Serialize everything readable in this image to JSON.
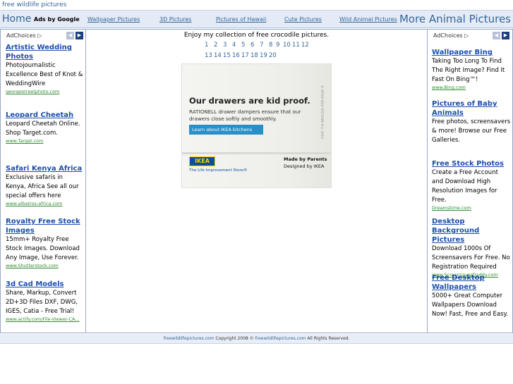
{
  "site": {
    "title": "free wildlife pictures"
  },
  "nav": {
    "home": "Home",
    "ads_by_google": "Ads by Google",
    "links": [
      "Wallpaper Pictures",
      "3D Pictures",
      "Pictures of Hawaii",
      "Cute Pictures",
      "Wild Animal Pictures"
    ],
    "more": "More Animal Pictures"
  },
  "left_ads": {
    "adchoices": "AdChoices ▷",
    "items": [
      {
        "title": "Artistic Wedding Photos",
        "desc": "Photojournalistic Excellence Best of Knot & WeddingWire",
        "url": "georgestreetphoto.com"
      },
      {
        "title": "Leopard Cheetah",
        "desc": "Leopard Cheetah Online. Shop Target.com.",
        "url": "www.Target.com"
      },
      {
        "title": "Safari Kenya Africa",
        "desc": "Exclusive safaris in Kenya, Africa See all our special offers here",
        "url": "www.albatros-africa.com"
      },
      {
        "title": "Royalty Free Stock Images",
        "desc": "15mm+ Royalty Free Stock Images. Download Any Image, Use Forever.",
        "url": "www.Shutterstock.com"
      },
      {
        "title": "3d Cad Models",
        "desc": "Share, Markup, Convert 2D+3D Files DXF, DWG, IGES, Catia - Free Trial!",
        "url": "www.actify.com/File-Viewer-CA..."
      }
    ]
  },
  "center": {
    "intro": "Enjoy my collection of free crocodile pictures.",
    "pages_row1": [
      "1",
      "2",
      "3",
      "4",
      "5",
      "6",
      "7",
      "8",
      "9",
      "10",
      "11",
      "12"
    ],
    "pages_row2": [
      "13",
      "14",
      "15",
      "16",
      "17",
      "18",
      "19",
      "20"
    ],
    "banner": {
      "headline": "Our drawers are kid proof.",
      "body": "RATIONELL drawer dampers ensure that our drawers close softly and smoothly.",
      "cta": "Learn about IKEA kitchens",
      "logo": "IKEA",
      "tagline": "The Life Improvement Store®",
      "made_by": "Made by Parents",
      "designed_by": "Designed by IKEA",
      "side_text": "© INTER IKEA SYSTEMS B.V. 2010"
    }
  },
  "right_ads": {
    "adchoices": "AdChoices ▷",
    "items": [
      {
        "title": "Wallpaper Bing",
        "desc": "Taking Too Long To Find The Right Image? Find It Fast On Bing™!",
        "url": "www.Bing.com"
      },
      {
        "title": "Pictures of Baby Animals",
        "desc": "Free photos, screensavers & more! Browse our Free Galleries.",
        "url": ""
      },
      {
        "title": "Free Stock Photos",
        "desc": "Create a Free Account and Download High Resolution Images for Free.",
        "url": "Dreamstime.com"
      },
      {
        "title": "Desktop Background Pictures",
        "desc": "Download 1000s Of Screensavers For Free. No Registration Required",
        "url": "www.ScreensaverDaddy.com"
      },
      {
        "title": "Free Desktop Wallpapers",
        "desc": "5000+ Great Computer Wallpapers Download Now! Fast, Free and Easy.",
        "url": ""
      }
    ]
  },
  "footer": {
    "site1": "freewildlifepictures.com",
    "copyright": " Copyright 2008 © ",
    "site2": "freewildlifepictures.com",
    "rights": " All Rights Reserved."
  },
  "colors": {
    "link": "#336699",
    "ad_title": "#1c4faa",
    "ad_url": "#2f8a2f",
    "nav_bg": "#e4ebf6"
  },
  "icons": {
    "prev": "chevron-left-icon",
    "next": "chevron-right-icon",
    "adchoices": "adchoices-triangle-icon"
  }
}
